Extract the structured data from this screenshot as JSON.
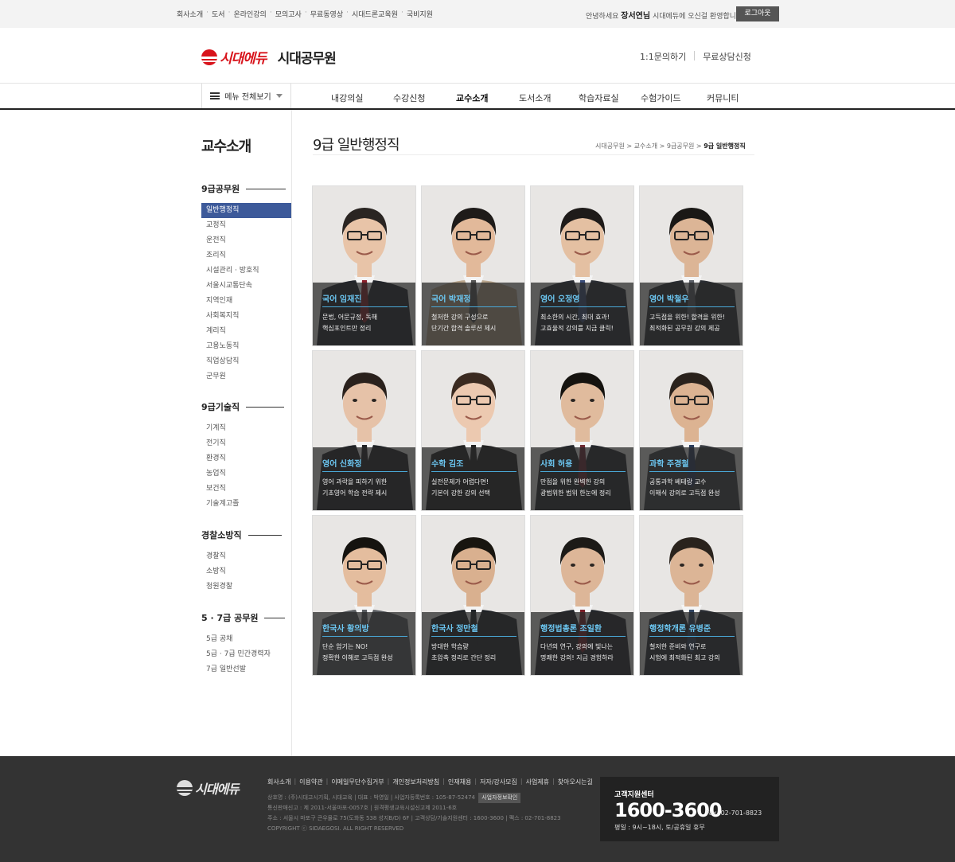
{
  "topbar": {
    "links": [
      "회사소개",
      "도서",
      "온라인강의",
      "모의고사",
      "무료동영상",
      "시대드론교육원",
      "국비지원"
    ],
    "greeting_prefix": "안녕하세요",
    "user_name": "장서연님",
    "greeting_suffix": "시대에듀에 오신걸 환영합니다.",
    "logout_label": "로그아웃"
  },
  "header": {
    "logo_text": "시대에듀",
    "site_name": "시대공무원",
    "links": [
      "1:1문의하기",
      "무료상담신청"
    ]
  },
  "gnb": {
    "menu_all_label": "메뉴 전체보기",
    "items": [
      "내강의실",
      "수강신청",
      "교수소개",
      "도서소개",
      "학습자료실",
      "수험가이드",
      "커뮤니티"
    ],
    "active": "교수소개"
  },
  "sidebar": {
    "title": "교수소개",
    "groups": [
      {
        "title": "9급공무원",
        "items": [
          "일반행정직",
          "교정직",
          "운전직",
          "조리직",
          "시설관리 · 방호직",
          "서울시교통단속",
          "지역인재",
          "사회복지직",
          "계리직",
          "고용노동직",
          "직업상담직",
          "군무원"
        ]
      },
      {
        "title": "9급기술직",
        "items": [
          "기계직",
          "전기직",
          "환경직",
          "농업직",
          "보건직",
          "기술계고졸"
        ]
      },
      {
        "title": "경찰소방직",
        "items": [
          "경찰직",
          "소방직",
          "청원경찰"
        ]
      },
      {
        "title": "5 · 7급 공무원",
        "items": [
          "5급 공채",
          "5급 · 7급 민간경력자",
          "7급 일반선발"
        ]
      }
    ],
    "active_item": "일반행정직"
  },
  "content": {
    "title": "9급 일반행정직",
    "breadcrumb": [
      "시대공무원",
      "교수소개",
      "9급공무원"
    ],
    "breadcrumb_current": "9급 일반행정직",
    "professors": [
      {
        "name": "국어 임재진",
        "desc": "문법, 어문규정, 독해\n핵심포인트만 정리",
        "suit": "#22252b",
        "tie": "#8a1f2a",
        "hair": "#2a2522",
        "skin": "#e8c4a8",
        "glasses": true
      },
      {
        "name": "국어 박재정",
        "desc": "철저한 강의 구성으로\n단기간 합격 솔루션 제시",
        "suit": "#b9a58c",
        "tie": "#555",
        "hair": "#1e1b19",
        "skin": "#e2b99a",
        "glasses": true
      },
      {
        "name": "영어 오정영",
        "desc": "최소한의 시간, 최대 효과!\n고효율적 강의를 지금 클릭!",
        "suit": "#2a2d33",
        "tie": "#3a4d7a",
        "hair": "#1e1b19",
        "skin": "#e4c0a2",
        "glasses": true
      },
      {
        "name": "영어 박철우",
        "desc": "고득점을 위한! 합격을 위한!\n최적화된 공무원 강의 제공",
        "suit": "#2b2e33",
        "tie": "#5b5f66",
        "hair": "#1a1816",
        "skin": "#dcb596",
        "glasses": true
      },
      {
        "name": "영어 신화정",
        "desc": "영어 과락을 피하기 위한\n기초영어 학습 전략 제시",
        "suit": "#1f2226",
        "tie": "#1f2226",
        "hair": "#2a211c",
        "skin": "#e6c2a8",
        "glasses": false
      },
      {
        "name": "수학 김조",
        "desc": "실전문제가 어렵다면!\n기본이 강한 강의 선택",
        "suit": "#222",
        "tie": "#222",
        "hair": "#3a2a20",
        "skin": "#ecc9b0",
        "glasses": true
      },
      {
        "name": "사회 허용",
        "desc": "만점을 위한 완벽한 강의\n광범위한 범위 한눈에 정리",
        "suit": "#24272c",
        "tie": "#6e2a33",
        "hair": "#15130f",
        "skin": "#e0bb9d",
        "glasses": false
      },
      {
        "name": "과학 주경철",
        "desc": "공통과학 베테랑 교수\n이해식 강의로 고득점 완성",
        "suit": "#3b3e44",
        "tie": "#2b3d5c",
        "hair": "#2a221c",
        "skin": "#dcb392",
        "glasses": true
      },
      {
        "name": "한국사 황의방",
        "desc": "단순 암기는 NO!\n정확한 이해로 고득점 완성",
        "suit": "#5a5d61",
        "tie": "#5a5d61",
        "hair": "#15130f",
        "skin": "#e4bd9e",
        "glasses": true
      },
      {
        "name": "한국사 정만철",
        "desc": "방대한 학습량\n초압축 정리로 간단 정리",
        "suit": "#202327",
        "tie": "#202327",
        "hair": "#18150f",
        "skin": "#d9b08f",
        "glasses": true
      },
      {
        "name": "행정법총론 조일환",
        "desc": "다년의 연구, 강의에 빛나는\n명쾌한 강의! 지금 경험하라",
        "suit": "#23262b",
        "tie": "#7a1f28",
        "hair": "#1c1a17",
        "skin": "#ddb698",
        "glasses": false
      },
      {
        "name": "행정학개론 유병준",
        "desc": "철저한 준비와 연구로\n시험에 최적화된 최고 강의",
        "suit": "#2a2d33",
        "tie": "#30435f",
        "hair": "#2a231d",
        "skin": "#dcb596",
        "glasses": false
      }
    ]
  },
  "footer": {
    "logo_text": "시대에듀",
    "links": [
      "회사소개",
      "이용약관",
      "이메일무단수집거부",
      "개인정보처리방침",
      "인재채용",
      "저자/강사모집",
      "사업제휴",
      "찾아오시는길"
    ],
    "info": [
      "상호명 : (주)시대고시기획, 시대교육 | 대표 : 박영일 | 사업자등록번호 : 105-87-52474",
      "통신판매신고 : 제 2011-서울마포-0057호 | 원격평생교육시설신고제 2011-6호",
      "주소 : 서울시 마포구 큰우물로 75(도화동 538 성지B/D) 6F | 고객상담/기술지원센터 : 1600-3600 | 팩스 : 02-701-8823",
      "COPYRIGHT ⓒ SIDAEGOSI. ALL RIGHT RESERVED"
    ],
    "biz_badge": "사업자정보확인",
    "cs_title": "고객지원센터",
    "cs_phone": "1600-3600",
    "cs_fax": "Fax. 02-701-8823",
    "cs_hours": "평일 : 9시~18시, 토/공휴일 휴무"
  }
}
